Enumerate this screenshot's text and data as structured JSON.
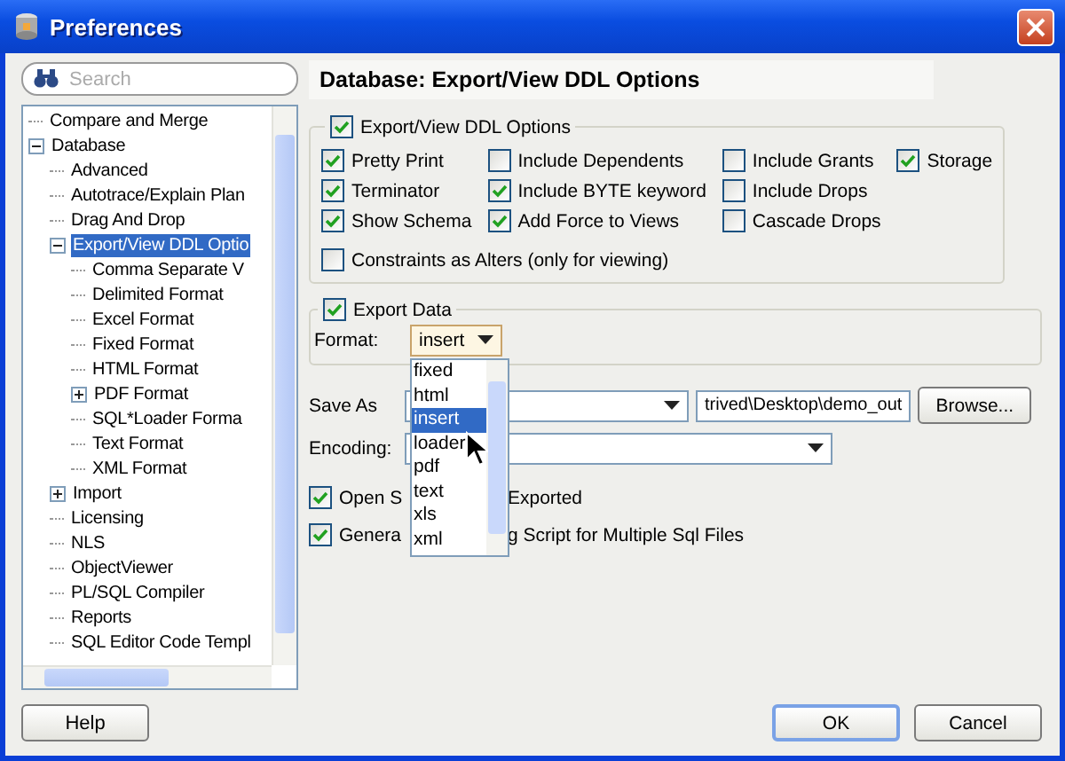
{
  "window": {
    "title": "Preferences"
  },
  "search": {
    "placeholder": "Search"
  },
  "tree": [
    {
      "label": "Compare and Merge",
      "selected": false
    },
    {
      "label": "Database",
      "selected": false,
      "expanded": true,
      "children": [
        {
          "label": "Advanced",
          "selected": false
        },
        {
          "label": "Autotrace/Explain Plan",
          "selected": false
        },
        {
          "label": "Drag And Drop",
          "selected": false
        },
        {
          "label": "Export/View DDL Optio",
          "selected": true,
          "expanded": true,
          "children": [
            {
              "label": "Comma Separate V",
              "selected": false
            },
            {
              "label": "Delimited Format",
              "selected": false
            },
            {
              "label": "Excel Format",
              "selected": false
            },
            {
              "label": "Fixed Format",
              "selected": false
            },
            {
              "label": "HTML Format",
              "selected": false
            },
            {
              "label": "PDF Format",
              "selected": false,
              "expanded": false
            },
            {
              "label": "SQL*Loader Forma",
              "selected": false
            },
            {
              "label": "Text Format",
              "selected": false
            },
            {
              "label": "XML Format",
              "selected": false
            }
          ]
        },
        {
          "label": "Import",
          "selected": false,
          "expanded": false
        },
        {
          "label": "Licensing",
          "selected": false
        },
        {
          "label": "NLS",
          "selected": false
        },
        {
          "label": "ObjectViewer",
          "selected": false
        },
        {
          "label": "PL/SQL Compiler",
          "selected": false
        },
        {
          "label": "Reports",
          "selected": false
        },
        {
          "label": "SQL Editor Code Templ",
          "selected": false
        }
      ]
    }
  ],
  "help_button": "Help",
  "page": {
    "title": "Database: Export/View DDL Options"
  },
  "ddl_options": {
    "label": "Export/View DDL Options",
    "checked": true,
    "rows": [
      {
        "items": [
          {
            "label": "Pretty Print",
            "checked": true
          },
          {
            "label": "Include Dependents",
            "checked": false
          },
          {
            "label": "Include Grants",
            "checked": false
          },
          {
            "label": "Storage",
            "checked": true
          }
        ]
      },
      {
        "items": [
          {
            "label": "Terminator",
            "checked": true
          },
          {
            "label": "Include BYTE keyword",
            "checked": true
          },
          {
            "label": "Include Drops",
            "checked": false
          }
        ]
      },
      {
        "items": [
          {
            "label": "Show Schema",
            "checked": true
          },
          {
            "label": "Add Force to Views",
            "checked": true
          },
          {
            "label": "Cascade Drops",
            "checked": false
          }
        ]
      }
    ],
    "extra": {
      "label": "Constraints as Alters (only for viewing)",
      "checked": false
    }
  },
  "export_data": {
    "label": "Export Data",
    "checked": true,
    "format": {
      "label": "Format:",
      "value": "insert",
      "open": true,
      "options": [
        {
          "label": "fixed",
          "selected": false
        },
        {
          "label": "html",
          "selected": false
        },
        {
          "label": "insert",
          "selected": true
        },
        {
          "label": "loader",
          "selected": false
        },
        {
          "label": "pdf",
          "selected": false
        },
        {
          "label": "text",
          "selected": false
        },
        {
          "label": "xls",
          "selected": false
        },
        {
          "label": "xml",
          "selected": false
        }
      ]
    }
  },
  "save_as": {
    "label": "Save As",
    "path": "trived\\Desktop\\demo_out",
    "browse": "Browse..."
  },
  "encoding": {
    "label": "Encoding:"
  },
  "checks": [
    {
      "parts": [
        "Open S",
        "Exported"
      ],
      "checked": true
    },
    {
      "parts": [
        "Genera",
        "g Script for Multiple Sql Files"
      ],
      "checked": true
    }
  ],
  "buttons": [
    {
      "label": "OK",
      "default": true
    },
    {
      "label": "Cancel",
      "default": false
    }
  ]
}
